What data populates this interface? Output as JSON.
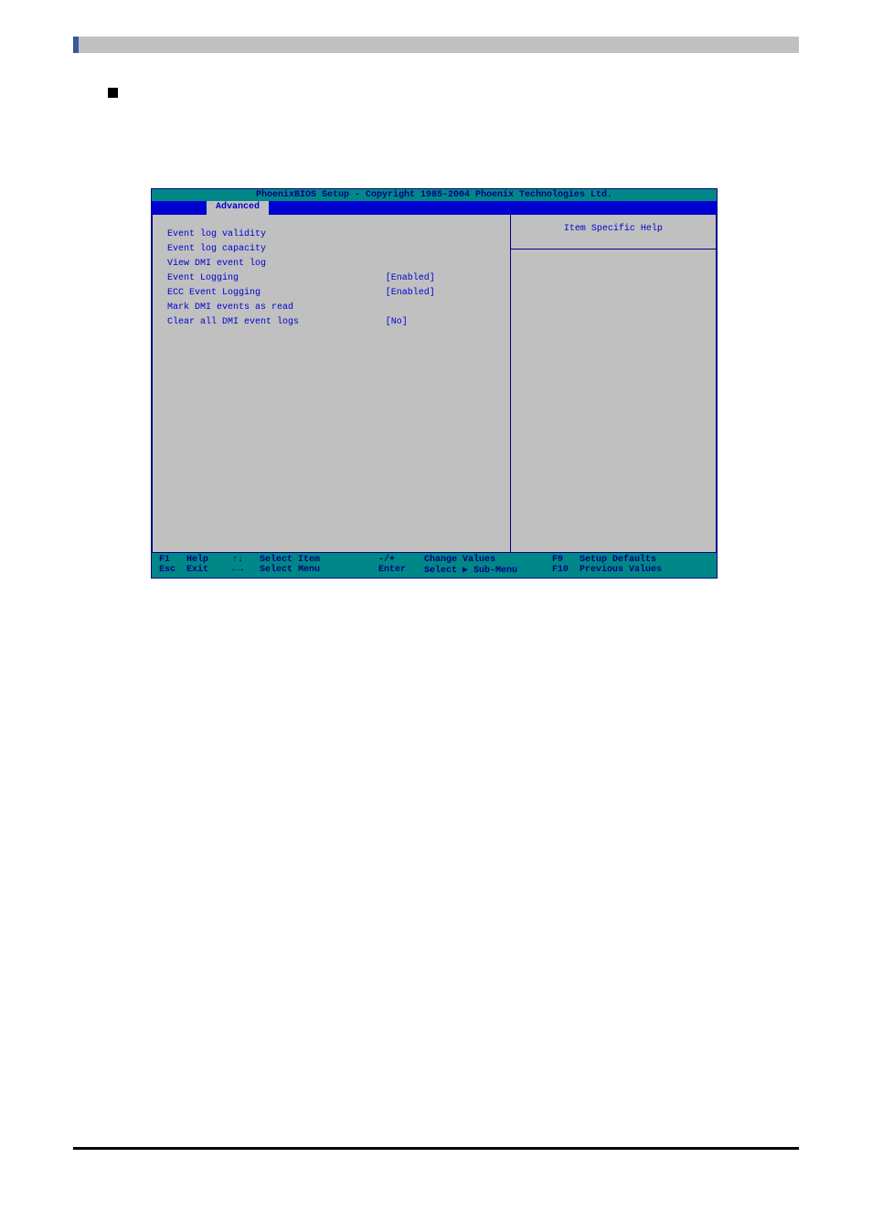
{
  "bios": {
    "title": "PhoenixBIOS Setup - Copyright 1985-2004 Phoenix Technologies Ltd.",
    "active_tab": "Advanced",
    "help_title": "Item Specific Help",
    "items": [
      {
        "label": "Event log validity",
        "value": ""
      },
      {
        "label": "Event log capacity",
        "value": ""
      },
      {
        "label": "",
        "value": ""
      },
      {
        "label": "View DMI event log",
        "value": ""
      },
      {
        "label": "",
        "value": ""
      },
      {
        "label": "Event Logging",
        "value": "[Enabled]"
      },
      {
        "label": "ECC Event Logging",
        "value": "[Enabled]"
      },
      {
        "label": "",
        "value": ""
      },
      {
        "label": "Mark DMI events as read",
        "value": ""
      },
      {
        "label": "Clear all DMI event logs",
        "value": "[No]"
      }
    ],
    "footer": {
      "row1": {
        "k": "F1",
        "a": "Help",
        "s": "↑↓",
        "i": "Select Item",
        "m": "-/+",
        "c": "Change Values",
        "r": "F9",
        "t": "Setup Defaults"
      },
      "row2": {
        "k": "Esc",
        "a": "Exit",
        "s": "←→",
        "i": "Select Menu",
        "m": "Enter",
        "c": "Select ▶ Sub-Menu",
        "r": "F10",
        "t": "Previous Values"
      }
    }
  }
}
